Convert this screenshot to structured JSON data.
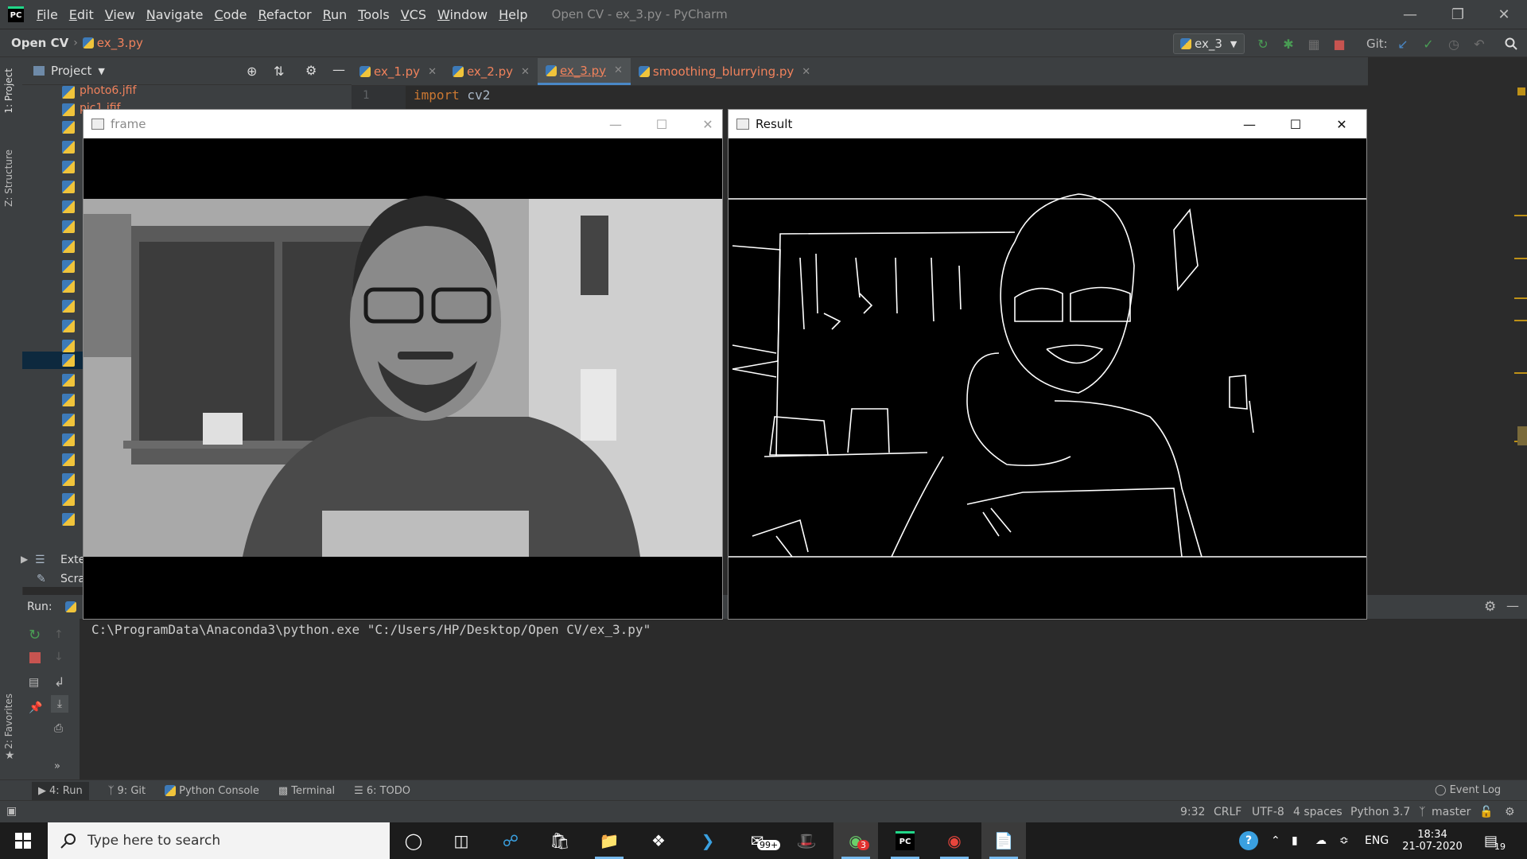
{
  "app": {
    "logo_text": "PC",
    "window_title": "Open CV - ex_3.py - PyCharm"
  },
  "menu": [
    "File",
    "Edit",
    "View",
    "Navigate",
    "Code",
    "Refactor",
    "Run",
    "Tools",
    "VCS",
    "Window",
    "Help"
  ],
  "navbar": {
    "project": "Open CV",
    "file": "ex_3.py",
    "run_config": "ex_3",
    "git_label": "Git:"
  },
  "project_panel": {
    "title": "Project",
    "files": [
      "photo6.jfif",
      "pic1.jfif"
    ],
    "external": "Exte",
    "scratches": "Scra"
  },
  "editor": {
    "tabs": [
      {
        "label": "ex_1.py",
        "active": false,
        "closable": true
      },
      {
        "label": "ex_2.py",
        "active": false,
        "closable": true
      },
      {
        "label": "ex_3.py",
        "active": true,
        "closable": true
      },
      {
        "label": "smoothing_blurrying.py",
        "active": false,
        "closable": true
      }
    ],
    "line_number": "1",
    "code_keyword": "import",
    "code_rest": " cv2"
  },
  "windows": {
    "frame": {
      "title": "frame"
    },
    "result": {
      "title": "Result"
    }
  },
  "left_strip": {
    "project_tab": "1: Project",
    "structure_tab": "Z: Structure",
    "favorites_tab": "2: Favorites"
  },
  "run": {
    "label": "Run:",
    "console": "C:\\ProgramData\\Anaconda3\\python.exe \"C:/Users/HP/Desktop/Open CV/ex_3.py\""
  },
  "bottom_bar": {
    "run": "4: Run",
    "git": "9: Git",
    "python_console": "Python Console",
    "terminal": "Terminal",
    "todo": "6: TODO",
    "event_log": "Event Log"
  },
  "status_bar": {
    "position": "9:32",
    "line_sep": "CRLF",
    "encoding": "UTF-8",
    "indent": "4 spaces",
    "interpreter": "Python 3.7",
    "branch": "master"
  },
  "taskbar": {
    "search_placeholder": "Type here to search",
    "mail_badge": "99+",
    "app_badge": "3",
    "language": "ENG",
    "time": "18:34",
    "date": "21-07-2020",
    "notifications": "19"
  },
  "colors": {
    "accent": "#4a88c7",
    "file_modified": "#f0825c",
    "run_green": "#499c54",
    "stop_red": "#c75450"
  }
}
